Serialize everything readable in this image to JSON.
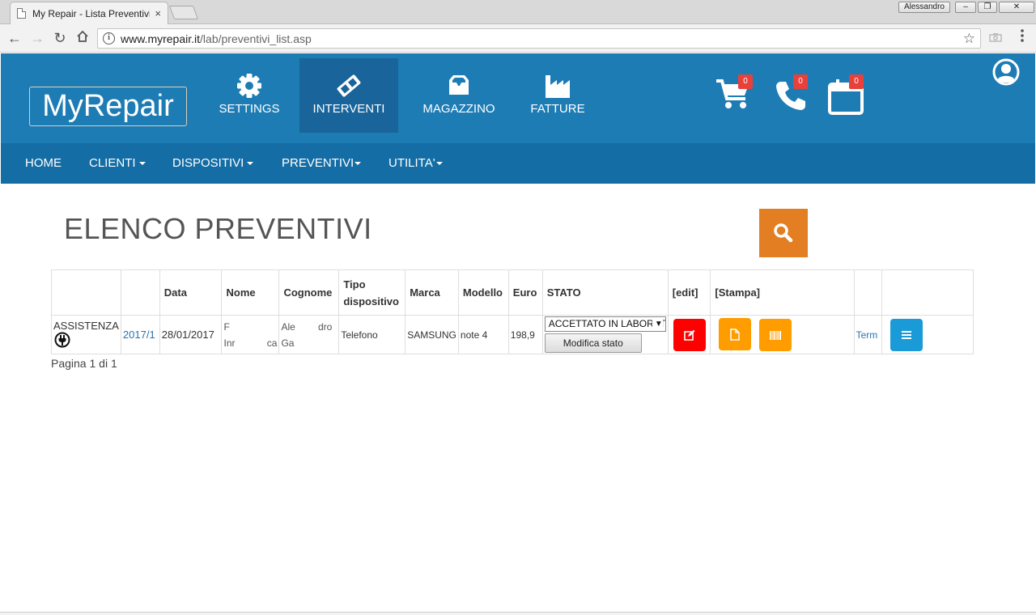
{
  "browser": {
    "tab_title": "My Repair - Lista Preventivi",
    "tab_close": "×",
    "window_user": "Alessandro",
    "url_host": "www.myrepair.it",
    "url_path": "/lab/preventivi_list.asp"
  },
  "header": {
    "brand": "MyRepair",
    "main_nav": [
      {
        "label": "SETTINGS",
        "icon": "gear-icon"
      },
      {
        "label": "INTERVENTI",
        "icon": "ticket-icon",
        "active": true
      },
      {
        "label": "MAGAZZINO",
        "icon": "inbox-icon"
      },
      {
        "label": "FATTURE",
        "icon": "factory-icon"
      }
    ],
    "quick_icons": [
      {
        "icon": "cart-icon",
        "badge": "0"
      },
      {
        "icon": "phone-icon",
        "badge": "0"
      },
      {
        "icon": "calendar-icon",
        "badge": "0"
      }
    ],
    "user_icon": "user-circle-icon"
  },
  "subnav": {
    "items": [
      {
        "label": "HOME",
        "dropdown": false
      },
      {
        "label": "CLIENTI",
        "dropdown": true
      },
      {
        "label": "DISPOSITIVI",
        "dropdown": true
      },
      {
        "label": "PREVENTIVI",
        "dropdown": true
      },
      {
        "label": "UTILITA'",
        "dropdown": true
      }
    ]
  },
  "main": {
    "title": "ELENCO PREVENTIVI",
    "search_icon": "search-icon",
    "table": {
      "headers": [
        "",
        "",
        "Data",
        "Nome",
        "Cognome",
        "Tipo dispositivo",
        "Marca",
        "Modello",
        "Euro",
        "STATO",
        "[edit]",
        "[Stampa]",
        "",
        ""
      ],
      "rows": [
        {
          "tipo": "ASSISTENZA",
          "numero": "2017/1",
          "data": "28/01/2017",
          "nome_line1": "F",
          "nome_line2a": "Inr",
          "nome_line2b": "ca",
          "cognome_line1a": "Ale",
          "cognome_line1b": "dro",
          "cognome_line2": "Ga",
          "tipo_dispositivo": "Telefono",
          "marca": "SAMSUNG",
          "modello": "note 4",
          "euro": "198,9",
          "stato": "ACCETTATO IN LABORATORIO",
          "stato_button": "Modifica stato",
          "term": "Term"
        }
      ]
    },
    "pager": "Pagina 1 di 1"
  },
  "colors": {
    "header_top": "#1e7cb5",
    "header_sub": "#146da5",
    "active_nav": "#19649a",
    "search": "#e47e22",
    "edit": "#ff0000",
    "print": "#ff9d00",
    "menu": "#1a9bd7",
    "badge": "#e8403a"
  }
}
